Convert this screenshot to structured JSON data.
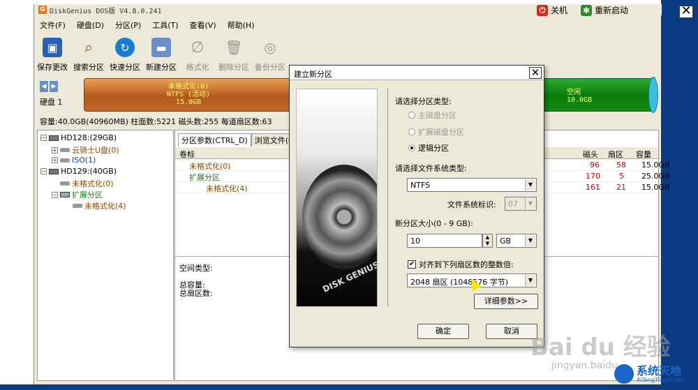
{
  "window": {
    "title": "DiskGenius DOS版 V4.8.0.241",
    "app_icon": "G",
    "shutdown_label": "关机",
    "restart_label": "重新启动",
    "close_glyph": "✕"
  },
  "menu": [
    "文件(F)",
    "硬盘(D)",
    "分区(P)",
    "工具(T)",
    "查看(V)",
    "帮助(H)"
  ],
  "toolbar": [
    {
      "label": "保存更改",
      "icon": "save-icon",
      "enabled": true
    },
    {
      "label": "搜索分区",
      "icon": "search-icon",
      "enabled": true
    },
    {
      "label": "快速分区",
      "icon": "quick-partition-icon",
      "enabled": true
    },
    {
      "label": "新建分区",
      "icon": "new-partition-icon",
      "enabled": true
    },
    {
      "label": "格式化",
      "icon": "format-icon",
      "enabled": false
    },
    {
      "label": "删除分区",
      "icon": "trash-icon",
      "enabled": false
    },
    {
      "label": "备份分区",
      "icon": "backup-icon",
      "enabled": false
    }
  ],
  "diskbar": {
    "disk_label": "硬盘 1",
    "partition": {
      "name": "未格式化(0)",
      "fs": "NTFS (活动)",
      "size": "15.0GB"
    },
    "free": {
      "name": "空闲",
      "size": "10.0GB"
    }
  },
  "disk_info": "容量:40.0GB(40960MB)  柱面数:5221  磁头数:255  每道扇区数:63",
  "tree": [
    {
      "label": "HD128:(29GB)",
      "type": "disk",
      "toggle": "−"
    },
    {
      "label": "云骑士U盘(0)",
      "type": "volume",
      "toggle": "+",
      "color": "brown"
    },
    {
      "label": "ISO(1)",
      "type": "volume",
      "toggle": "+",
      "color": "blue"
    },
    {
      "label": "HD129:(40GB)",
      "type": "disk",
      "toggle": "−"
    },
    {
      "label": "未格式化(0)",
      "type": "volume",
      "color": "brown"
    },
    {
      "label": "扩展分区",
      "type": "extended",
      "toggle": "−",
      "color": "green"
    },
    {
      "label": "未格式化(4)",
      "type": "volume",
      "color": "brown"
    }
  ],
  "tabs": [
    "分区参数(CTRL_D)",
    "浏览文件(C"
  ],
  "table": {
    "headers": {
      "volume": "卷标",
      "head": "磁头",
      "sector": "扇区",
      "capacity": "容量"
    },
    "rows": [
      {
        "volume": "未格式化(0)",
        "head": "96",
        "sector": "58",
        "capacity": "15.0GB"
      },
      {
        "volume": "扩展分区",
        "head": "170",
        "sector": "5",
        "capacity": "25.0GB"
      },
      {
        "volume": "未格式化(4)",
        "head": "161",
        "sector": "21",
        "capacity": "15.0GB"
      }
    ]
  },
  "lower_info": {
    "space_type": "空间类型:",
    "total_capacity": "总容量:",
    "total_sectors": "总扇区数:"
  },
  "dialog": {
    "title": "建立新分区",
    "close_glyph": "✕",
    "logo_text": "DISK GENIUS",
    "partition_type_label": "请选择分区类型:",
    "options": [
      {
        "label": "主磁盘分区",
        "selected": false,
        "enabled": false
      },
      {
        "label": "扩展磁盘分区",
        "selected": false,
        "enabled": false
      },
      {
        "label": "逻辑分区",
        "selected": true,
        "enabled": true
      }
    ],
    "fs_label": "请选择文件系统类型:",
    "fs_value": "NTFS",
    "fs_id_label": "文件系统标识:",
    "fs_id_value": "07",
    "size_label": "新分区大小(0 - 9 GB):",
    "size_value": "10",
    "size_unit": "GB",
    "align_label": "对齐到下列扇区数的整数倍:",
    "align_checked": true,
    "align_value": "2048 扇区 (1048576 字节)",
    "detail_button": "详细参数>>",
    "ok_button": "确定",
    "cancel_button": "取消"
  },
  "watermarks": {
    "baidu": "Bai du 经验",
    "jingyan": "jingyan.baidu",
    "site_cn": "系统天地",
    "site_en": "XiTongTianDi.net"
  }
}
